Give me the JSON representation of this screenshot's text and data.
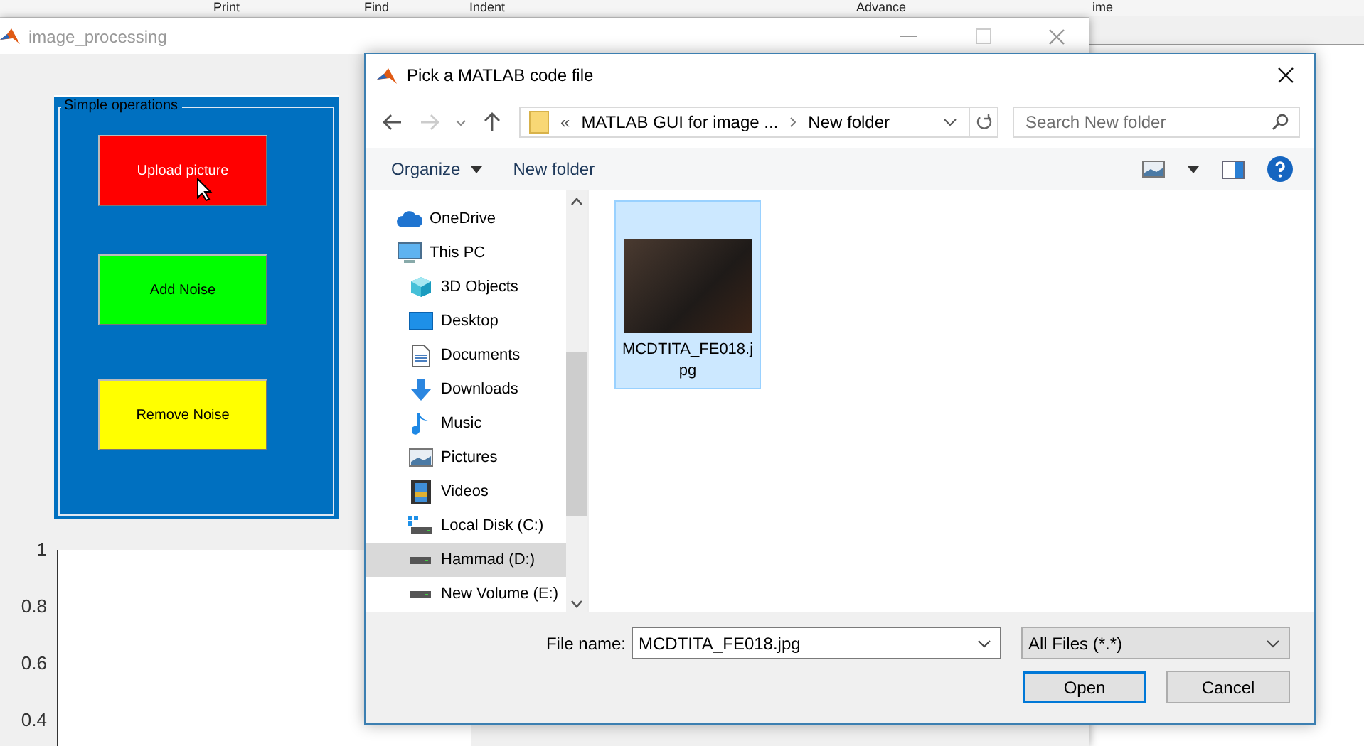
{
  "background_toolbar": {
    "items": [
      "Print",
      "Find",
      "Indent",
      "Advance",
      "ime"
    ]
  },
  "figure_window": {
    "title": "image_processing",
    "panel": {
      "title": "Simple operations",
      "buttons": [
        {
          "label": "Upload picture",
          "color": "#ff0000",
          "hovered": true
        },
        {
          "label": "Add Noise",
          "color": "#00ff00",
          "hovered": false
        },
        {
          "label": "Remove Noise",
          "color": "#ffff00",
          "hovered": false
        }
      ]
    },
    "axes": {
      "y_ticks": [
        "1",
        "0.8",
        "0.6",
        "0.4"
      ]
    }
  },
  "dialog": {
    "title": "Pick a MATLAB code file",
    "address": {
      "overflow": "«",
      "segments": [
        "MATLAB GUI for image ...",
        "New folder"
      ]
    },
    "search": {
      "placeholder": "Search New folder"
    },
    "commands": [
      {
        "label": "Organize",
        "has_menu": true
      },
      {
        "label": "New folder",
        "has_menu": false
      }
    ],
    "nav_pane": {
      "items": [
        {
          "label": "OneDrive",
          "kind": "cloud",
          "selected": false
        },
        {
          "label": "This PC",
          "kind": "computer",
          "selected": false,
          "children": [
            {
              "label": "3D Objects",
              "kind": "cube",
              "selected": false
            },
            {
              "label": "Desktop",
              "kind": "desktop",
              "selected": false
            },
            {
              "label": "Documents",
              "kind": "document",
              "selected": false
            },
            {
              "label": "Downloads",
              "kind": "download",
              "selected": false
            },
            {
              "label": "Music",
              "kind": "music",
              "selected": false
            },
            {
              "label": "Pictures",
              "kind": "pictures",
              "selected": false
            },
            {
              "label": "Videos",
              "kind": "video",
              "selected": false
            },
            {
              "label": "Local Disk (C:)",
              "kind": "system-disk",
              "selected": false
            },
            {
              "label": "Hammad (D:)",
              "kind": "drive",
              "selected": true
            },
            {
              "label": "New Volume (E:)",
              "kind": "drive",
              "selected": false
            }
          ]
        }
      ]
    },
    "files": [
      {
        "name": "MCDTITA_FE018.jpg",
        "selected": true
      }
    ],
    "file_name": {
      "label": "File name:",
      "value": "MCDTITA_FE018.jpg"
    },
    "file_type": {
      "value": "All Files (*.*)"
    },
    "buttons": [
      {
        "label": "Open",
        "default": true
      },
      {
        "label": "Cancel",
        "default": false
      }
    ]
  }
}
